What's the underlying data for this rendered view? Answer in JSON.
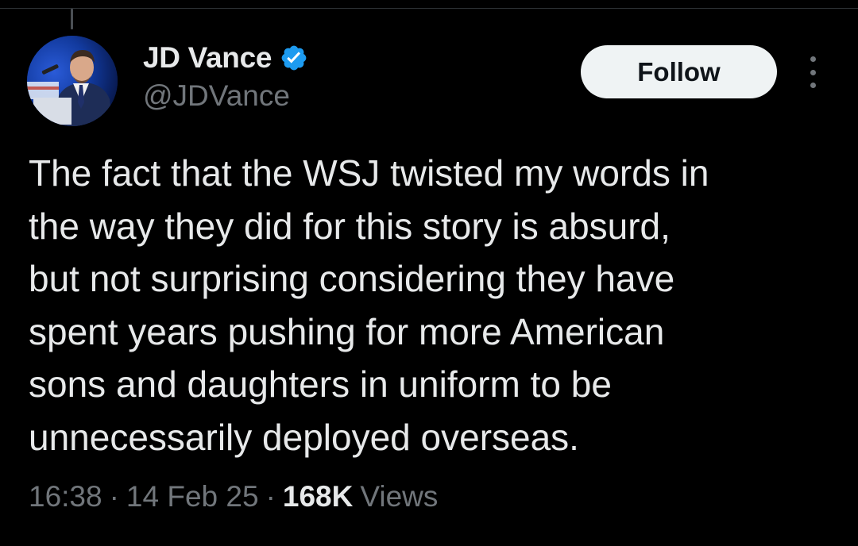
{
  "tweet": {
    "author": {
      "display_name": "JD Vance",
      "handle": "@JDVance",
      "verified": true,
      "verified_icon": "verified-badge-icon",
      "avatar": "avatar-photo"
    },
    "follow_label": "Follow",
    "more_icon": "more-options-icon",
    "text_lines": [
      "The fact that the WSJ twisted my words in",
      "the way they did for this story is absurd,",
      "but not surprising considering they have",
      "spent years pushing for more American",
      "sons and daughters in uniform to be",
      "unnecessarily deployed overseas."
    ],
    "meta": {
      "time": "16:38",
      "separator": "·",
      "date": "14 Feb 25",
      "views_count": "168K",
      "views_label": "Views"
    }
  },
  "colors": {
    "background": "#000000",
    "primary_text": "#e7e9ea",
    "secondary_text": "#71767b",
    "follow_button_bg": "#eff3f4",
    "follow_button_text": "#0f1419",
    "verified_badge": "#1d9bf0"
  }
}
